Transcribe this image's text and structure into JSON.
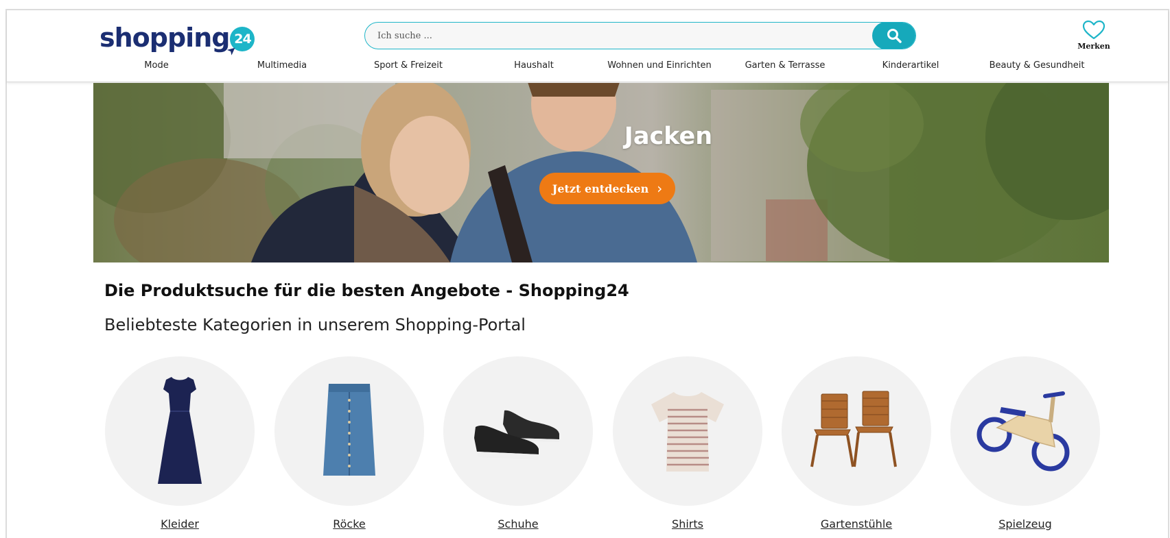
{
  "logo": {
    "text": "shopping",
    "badge": "24"
  },
  "search": {
    "placeholder": "Ich suche ..."
  },
  "wishlist": {
    "label": "Merken"
  },
  "nav": {
    "items": [
      {
        "label": "Mode"
      },
      {
        "label": "Multimedia"
      },
      {
        "label": "Sport & Freizeit"
      },
      {
        "label": "Haushalt"
      },
      {
        "label": "Wohnen und Einrichten"
      },
      {
        "label": "Garten & Terrasse"
      },
      {
        "label": "Kinderartikel"
      },
      {
        "label": "Beauty & Gesundheit"
      }
    ]
  },
  "hero": {
    "title": "Jacken",
    "cta_label": "Jetzt entdecken"
  },
  "main": {
    "headline": "Die Produktsuche für die besten Angebote - Shopping24",
    "subheadline": "Beliebteste Kategorien in unserem Shopping-Portal"
  },
  "categories": [
    {
      "label": "Kleider",
      "icon": "dress-icon"
    },
    {
      "label": "Röcke",
      "icon": "skirt-icon"
    },
    {
      "label": "Schuhe",
      "icon": "sneakers-icon"
    },
    {
      "label": "Shirts",
      "icon": "shirt-icon"
    },
    {
      "label": "Gartenstühle",
      "icon": "garden-chairs-icon"
    },
    {
      "label": "Spielzeug",
      "icon": "balance-bike-icon"
    }
  ],
  "colors": {
    "brand_navy": "#1b2e72",
    "brand_teal": "#1db5c8",
    "cta_orange": "#ee7a14"
  }
}
